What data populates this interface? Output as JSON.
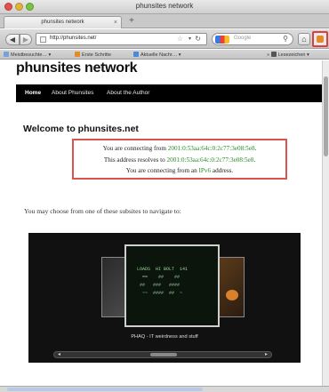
{
  "window": {
    "title": "phunsites network"
  },
  "tabs": [
    {
      "label": "phunsites network"
    }
  ],
  "toolbar": {
    "back_label": "◀",
    "forward_label": "▶",
    "url": "http://phunsites.net/",
    "search_placeholder": "Google",
    "home_icon": "home-icon"
  },
  "bookmarks": [
    {
      "label": "Meistbesuchte…",
      "color": "#7aa0d6"
    },
    {
      "label": "Erste Schritte",
      "color": "#e38a2a"
    },
    {
      "label": "Aktuelle Nachr…",
      "color": "#4a8ad6"
    },
    {
      "label": "Lesezeichen",
      "color": "#555555"
    }
  ],
  "site": {
    "title": "phunsites network",
    "nav": [
      "Home",
      "About Phunsites",
      "About the Author"
    ],
    "welcome": "Welcome to phunsites.net",
    "info": {
      "line1_prefix": "You are connecting from ",
      "line1_value": "2001:0:53aa:64c:0:2c77:3e08:5e8",
      "line1_suffix": ".",
      "line2_prefix": "This address resolves to ",
      "line2_value": "2001:0:53aa:64c:0:2c77:3e08:5e8",
      "line2_suffix": ".",
      "line3_prefix": "You are connecting from an ",
      "line3_value": "IPv6",
      "line3_suffix": " address."
    },
    "choose_text": "You may choose from one of these subsites to navigate to:",
    "showcase_caption": "PHAQ - IT weirdness and stuff"
  },
  "colors": {
    "accent_green": "#2c8a2c",
    "box_border": "#d9534f"
  }
}
